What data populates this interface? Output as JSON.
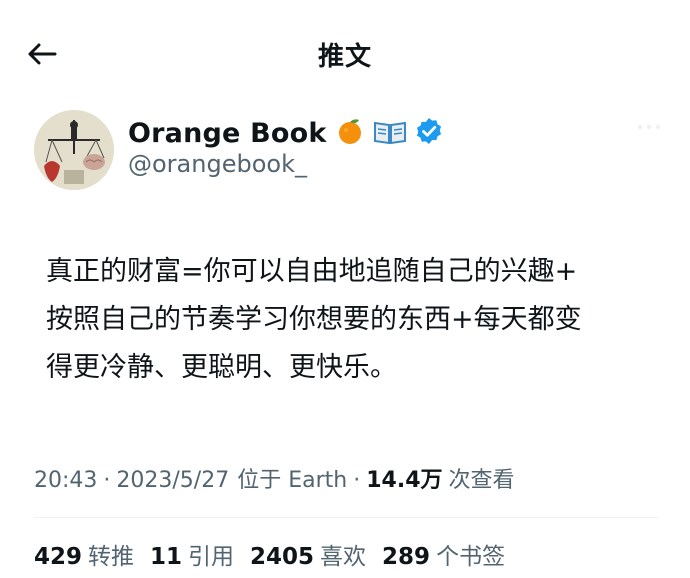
{
  "header": {
    "title": "推文",
    "back_icon": "arrow-left-icon"
  },
  "author": {
    "name": "Orange Book",
    "handle": "@orangebook_",
    "badges": [
      "orange-emoji-icon",
      "open-book-emoji-icon",
      "verified-badge-icon"
    ],
    "verified_color": "#1d9bf0"
  },
  "tweet": {
    "lines": [
      "真正的财富=你可以自由地追随自己的兴趣+",
      "按照自己的节奏学习你想要的东西+每天都变",
      "得更冷静、更聪明、更快乐。"
    ]
  },
  "meta": {
    "time": "20:43",
    "dot1": "·",
    "date": "2023/5/27",
    "location": "位于 Earth",
    "dot2": "·",
    "views": "14.4万",
    "views_label": "次查看"
  },
  "stats": [
    {
      "num": "429",
      "label": "转推"
    },
    {
      "num": "11",
      "label": "引用"
    },
    {
      "num": "2405",
      "label": "喜欢"
    },
    {
      "num": "289",
      "label": "个书签"
    }
  ]
}
